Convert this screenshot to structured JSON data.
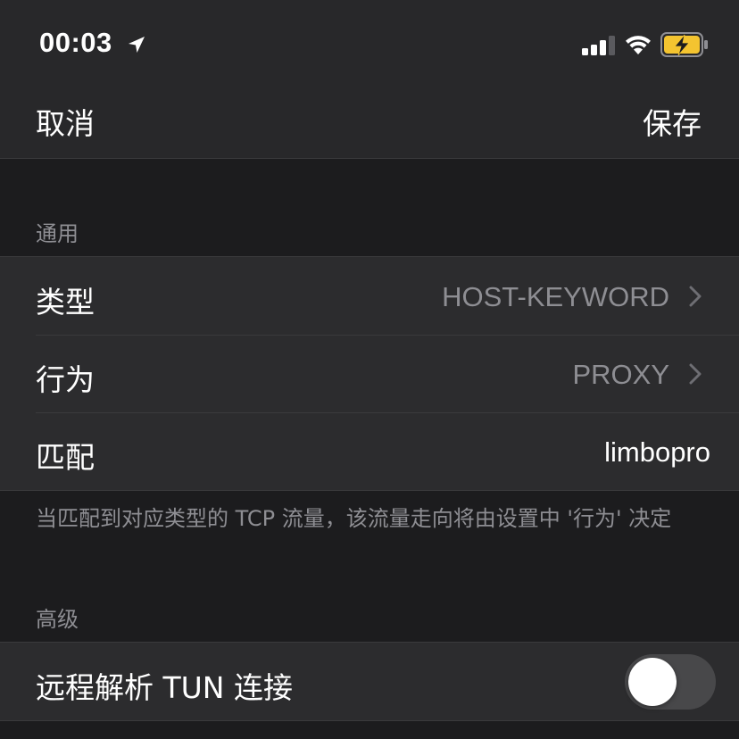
{
  "status_bar": {
    "time": "00:03",
    "icons": [
      "location-arrow-icon",
      "cellular-signal-icon",
      "wifi-icon",
      "battery-charging-icon"
    ],
    "battery_color": "#f4c430"
  },
  "nav": {
    "cancel_label": "取消",
    "save_label": "保存"
  },
  "sections": {
    "general": {
      "header": "通用",
      "rows": [
        {
          "label": "类型",
          "value": "HOST-KEYWORD"
        },
        {
          "label": "行为",
          "value": "PROXY"
        },
        {
          "label": "匹配",
          "value": "limbopro"
        }
      ],
      "footer": "当匹配到对应类型的 TCP 流量，该流量走向将由设置中 '行为' 决定"
    },
    "advanced": {
      "header": "高级",
      "rows": [
        {
          "label": "远程解析 TUN 连接",
          "toggle_on": false
        }
      ]
    }
  },
  "colors": {
    "background": "#1c1c1e",
    "cell": "#2c2c2e",
    "secondary_text": "#8e8e93",
    "toggle_off": "#48484a"
  }
}
